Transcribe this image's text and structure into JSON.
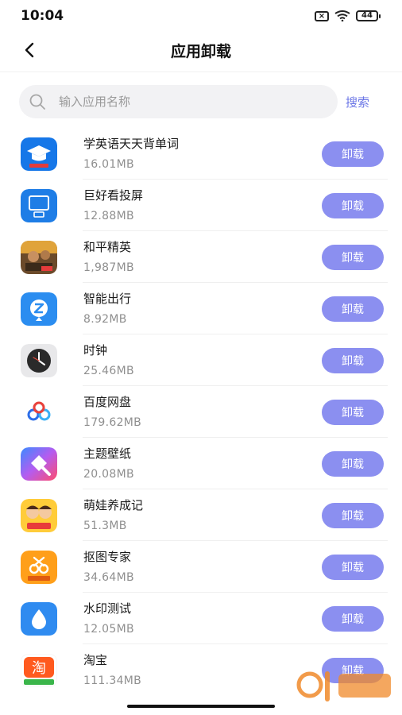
{
  "status_bar": {
    "time": "10:04",
    "battery": "44"
  },
  "header": {
    "title": "应用卸载"
  },
  "search": {
    "placeholder": "输入应用名称",
    "action_label": "搜索"
  },
  "apps": [
    {
      "name": "学英语天天背单词",
      "size": "16.01MB",
      "button": "卸载",
      "icon": "english-words-icon"
    },
    {
      "name": "巨好看投屏",
      "size": "12.88MB",
      "button": "卸载",
      "icon": "screen-cast-icon"
    },
    {
      "name": "和平精英",
      "size": "1,987MB",
      "button": "卸载",
      "icon": "game-icon"
    },
    {
      "name": "智能出行",
      "size": "8.92MB",
      "button": "卸载",
      "icon": "smart-travel-icon"
    },
    {
      "name": "时钟",
      "size": "25.46MB",
      "button": "卸载",
      "icon": "clock-icon"
    },
    {
      "name": "百度网盘",
      "size": "179.62MB",
      "button": "卸载",
      "icon": "cloud-disk-icon"
    },
    {
      "name": "主题壁纸",
      "size": "20.08MB",
      "button": "卸载",
      "icon": "theme-wallpaper-icon"
    },
    {
      "name": "萌娃养成记",
      "size": "51.3MB",
      "button": "卸载",
      "icon": "cute-kid-game-icon"
    },
    {
      "name": "抠图专家",
      "size": "34.64MB",
      "button": "卸载",
      "icon": "cutout-expert-icon"
    },
    {
      "name": "水印测试",
      "size": "12.05MB",
      "button": "卸载",
      "icon": "watermark-test-icon"
    },
    {
      "name": "淘宝",
      "size": "111.34MB",
      "button": "卸载",
      "icon": "taobao-icon"
    }
  ],
  "colors": {
    "accent": "#8b8ff0",
    "link": "#6b76e6"
  }
}
